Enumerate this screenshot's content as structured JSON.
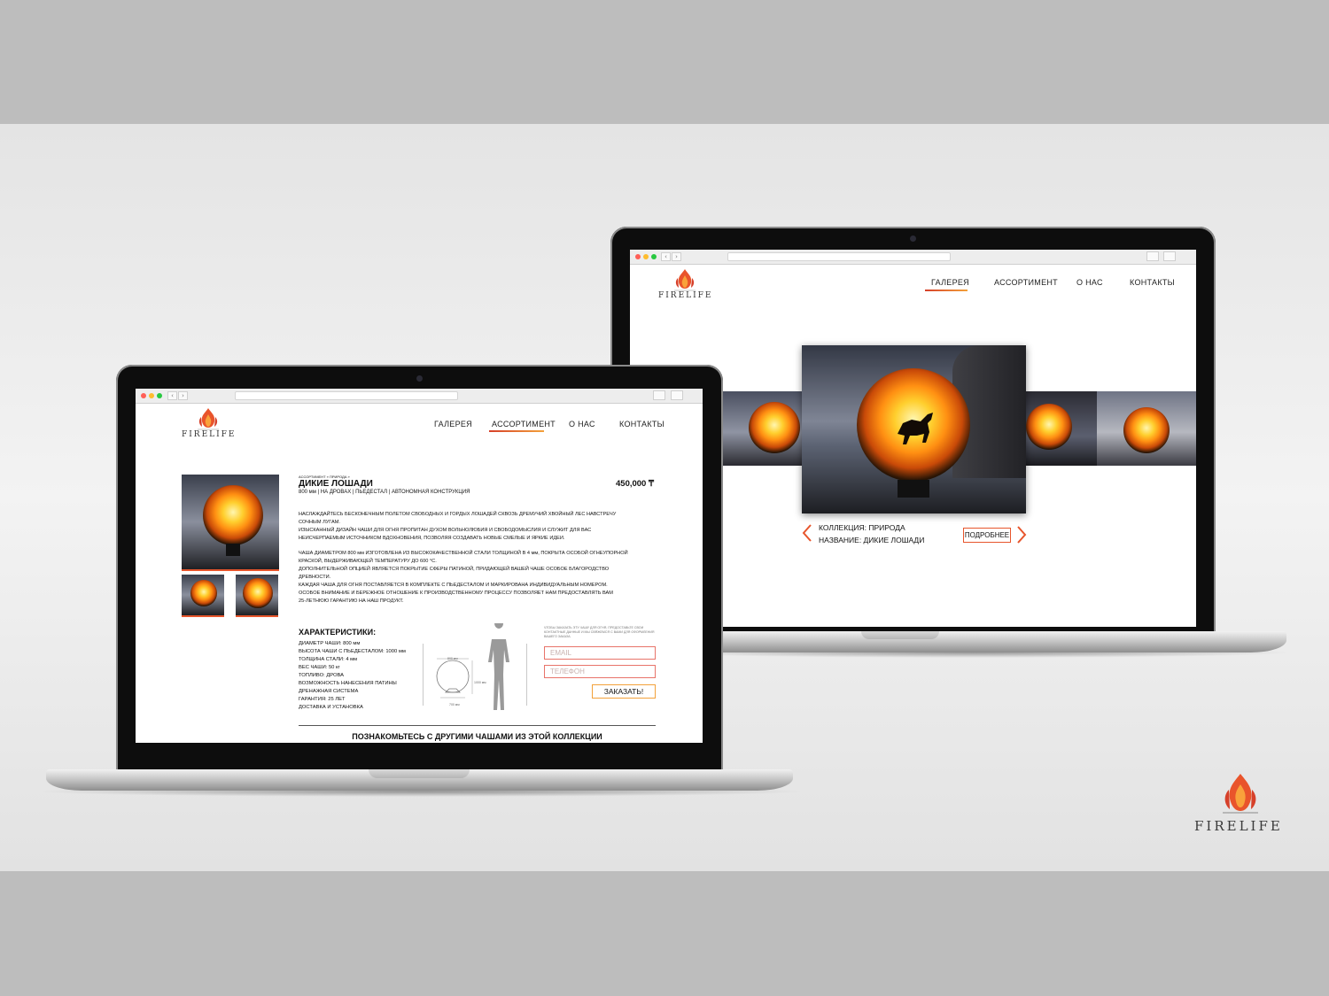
{
  "brand_name": "FIRELIFE",
  "colors": {
    "accent": "#e7552c",
    "accent_light": "#f3a13a",
    "text": "#111111"
  },
  "gallery_page": {
    "nav": [
      {
        "label": "ГАЛЕРЕЯ",
        "active": true
      },
      {
        "label": "АССОРТИМЕНТ",
        "active": false
      },
      {
        "label": "О НАС",
        "active": false
      },
      {
        "label": "КОНТАКТЫ",
        "active": false
      }
    ],
    "collection_label": "КОЛЛЕКЦИЯ: ПРИРОДА",
    "name_label": "НАЗВАНИЕ: ДИКИЕ ЛОШАДИ",
    "more_button": "ПОДРОБНЕЕ",
    "prev_icon": "chevron-left-icon",
    "next_icon": "chevron-right-icon"
  },
  "product_page": {
    "nav": [
      {
        "label": "ГАЛЕРЕЯ",
        "active": false
      },
      {
        "label": "АССОРТИМЕНТ",
        "active": true
      },
      {
        "label": "О НАС",
        "active": false
      },
      {
        "label": "КОНТАКТЫ",
        "active": false
      }
    ],
    "breadcrumb": "АССОРТИМЕНТ » ПРИРОДА »",
    "title": "ДИКИЕ ЛОШАДИ",
    "subtitle": "800 мм | НА ДРОВАХ | ПЬЕДЕСТАЛ | АВТОНОМНАЯ КОНСТРУКЦИЯ",
    "price": "450,000 ₸",
    "desc1": [
      "НАСЛАЖДАЙТЕСЬ БЕСКОНЕЧНЫМ ПОЛЕТОМ СВОБОДНЫХ И ГОРДЫХ ЛОШАДЕЙ СКВОЗЬ ДРЕМУЧИЙ ХВОЙНЫЙ ЛЕС НАВСТРЕЧУ",
      "СОЧНЫМ ЛУГАМ.",
      "ИЗЫСКАННЫЙ ДИЗАЙН ЧАШИ ДЛЯ ОГНЯ ПРОПИТАН ДУХОМ ВОЛЬНОЛЮБИЯ И СВОБОДОМЫСЛИЯ И СЛУЖИТ ДЛЯ ВАС",
      "НЕИСЧЕРПАЕМЫМ ИСТОЧНИКОМ ВДОХНОВЕНИЯ, ПОЗВОЛЯЯ СОЗДАВАТЬ НОВЫЕ СМЕЛЫЕ И ЯРКИЕ ИДЕИ."
    ],
    "desc2": [
      "ЧАША ДИАМЕТРОМ 800 мм ИЗГОТОВЛЕНА ИЗ ВЫСОКОКАЧЕСТВЕННОЙ СТАЛИ ТОЛЩИНОЙ В 4 мм, ПОКРЫТА ОСОБОЙ ОГНЕУПОРНОЙ",
      "КРАСКОЙ, ВЫДЕРЖИВАЮЩЕЙ ТЕМПЕРАТУРУ ДО 600 °С.",
      "ДОПОЛНИТЕЛЬНОЙ ОПЦИЕЙ ЯВЛЯЕТСЯ ПОКРЫТИЕ СФЕРЫ ПАТИНОЙ, ПРИДАЮЩЕЙ ВАШЕЙ ЧАШЕ ОСОБОЕ БЛАГОРОДСТВО",
      "ДРЕВНОСТИ.",
      "КАЖДАЯ ЧАША ДЛЯ ОГНЯ ПОСТАВЛЯЕТСЯ В КОМПЛЕКТЕ С ПЬЕДЕСТАЛОМ И МАРКИРОВАНА ИНДИВИДУАЛЬНЫМ НОМЕРОМ.",
      "ОСОБОЕ ВНИМАНИЕ И БЕРЕЖНОЕ ОТНОШЕНИЕ К ПРОИЗВОДСТВЕННОМУ ПРОЦЕССУ ПОЗВОЛЯЕТ НАМ ПРЕДОСТАВЛЯТЬ ВАМ",
      "25-ЛЕТНЮЮ ГАРАНТИЮ НА НАШ ПРОДУКТ."
    ],
    "specs_heading": "ХАРАКТЕРИСТИКИ:",
    "specs": [
      "ДИАМЕТР ЧАШИ: 800 мм",
      "ВЫСОТА ЧАШИ С ПЬЕДЕСТАЛОМ: 1000 мм",
      "ТОЛЩИНА СТАЛИ: 4 мм",
      "ВЕС ЧАШИ: 50 кг",
      "ТОПЛИВО: ДРОВА",
      "ВОЗМОЖНОСТЬ НАНЕСЕНИЯ ПАТИНЫ",
      "ДРЕНАЖНАЯ СИСТЕМА",
      "ГАРАНТИЯ: 25 ЛЕТ",
      "ДОСТАВКА И УСТАНОВКА"
    ],
    "dims": {
      "top": "800 мм",
      "side": "1000 мм",
      "bottom": "700 мм"
    },
    "order_hint": [
      "ЧТОБЫ ЗАКАЗАТЬ ЭТУ ЧАШУ ДЛЯ ОГНЯ, ПРЕДОСТАВЬТЕ СВОИ",
      "КОНТАКТНЫЕ ДАННЫЕ И МЫ СВЯЖЕМСЯ С ВАМИ ДЛЯ ОФОРМЛЕНИЯ",
      "ВАШЕГО ЗАКАЗА."
    ],
    "email_placeholder": "EMAIL",
    "phone_placeholder": "ТЕЛЕФОН",
    "order_button": "ЗАКАЗАТЬ!",
    "more_heading": "ПОЗНАКОМЬТЕСЬ С ДРУГИМИ ЧАШАМИ ИЗ ЭТОЙ КОЛЛЕКЦИИ"
  }
}
